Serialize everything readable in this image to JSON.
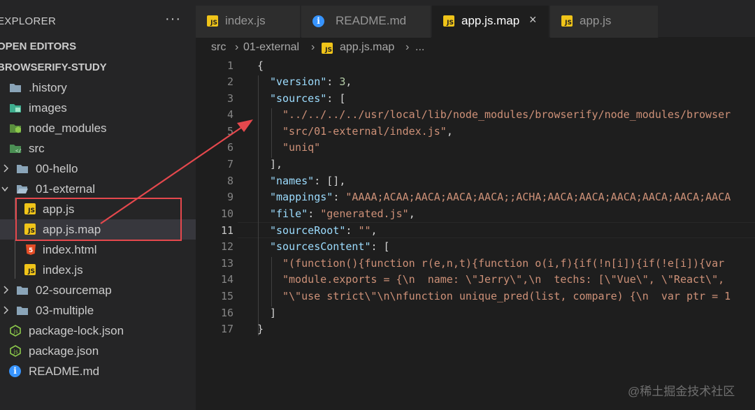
{
  "explorer": {
    "title": "EXPLORER",
    "more": "···",
    "open_editors": "OPEN EDITORS",
    "project": "BROWSERIFY-STUDY",
    "items": [
      {
        "label": ".history",
        "icon": "folder-icon"
      },
      {
        "label": "images",
        "icon": "images-folder-icon"
      },
      {
        "label": "node_modules",
        "icon": "node-folder-icon"
      },
      {
        "label": "src",
        "icon": "src-folder-icon"
      },
      {
        "label": "00-hello",
        "icon": "folder-icon"
      },
      {
        "label": "01-external",
        "icon": "folder-open-icon"
      },
      {
        "label": "app.js",
        "icon": "js-file-icon"
      },
      {
        "label": "app.js.map",
        "icon": "js-file-icon"
      },
      {
        "label": "index.html",
        "icon": "html-file-icon"
      },
      {
        "label": "index.js",
        "icon": "js-file-icon"
      },
      {
        "label": "02-sourcemap",
        "icon": "folder-icon"
      },
      {
        "label": "03-multiple",
        "icon": "folder-icon"
      },
      {
        "label": "package-lock.json",
        "icon": "json-file-icon"
      },
      {
        "label": "package.json",
        "icon": "json-file-icon"
      },
      {
        "label": "README.md",
        "icon": "info-icon"
      }
    ]
  },
  "tabs": [
    {
      "label": "index.js",
      "icon": "js-file-icon"
    },
    {
      "label": "README.md",
      "icon": "info-icon"
    },
    {
      "label": "app.js.map",
      "icon": "js-file-icon",
      "active": true
    },
    {
      "label": "app.js",
      "icon": "js-file-icon"
    }
  ],
  "tab_close": "×",
  "breadcrumb": [
    "src",
    "01-external",
    "app.js.map",
    "..."
  ],
  "breadcrumb_sep": "›",
  "editor": {
    "line_numbers": [
      "1",
      "2",
      "3",
      "4",
      "5",
      "6",
      "7",
      "8",
      "9",
      "10",
      "11",
      "12",
      "13",
      "14",
      "15",
      "16",
      "17"
    ],
    "current_line": "11"
  },
  "code": {
    "l1": "{",
    "l2_key": "\"version\"",
    "l2_rest": ": ",
    "l2_val": "3",
    "l2_end": ",",
    "l3_key": "\"sources\"",
    "l3_rest": ": [",
    "l4": "\"../../../../usr/local/lib/node_modules/browserify/node_modules/browser",
    "l5": "\"src/01-external/index.js\"",
    "l5_end": ",",
    "l6": "\"uniq\"",
    "l7": "],",
    "l8_key": "\"names\"",
    "l8_rest": ": [],",
    "l9_key": "\"mappings\"",
    "l9_rest": ": ",
    "l9_val": "\"AAAA;ACAA;AACA;AACA;AACA;;ACHA;AACA;AACA;AACA;AACA;AACA;AACA",
    "l10_key": "\"file\"",
    "l10_rest": ": ",
    "l10_val": "\"generated.js\"",
    "l10_end": ",",
    "l11_key": "\"sourceRoot\"",
    "l11_rest": ": ",
    "l11_val": "\"\"",
    "l11_end": ",",
    "l12_key": "\"sourcesContent\"",
    "l12_rest": ": [",
    "l13": "\"(function(){function r(e,n,t){function o(i,f){if(!n[i]){if(!e[i]){var",
    "l14": "\"module.exports = {\\n  name: \\\"Jerry\\\",\\n  techs: [\\\"Vue\\\", \\\"React\\\",",
    "l15": "\"\\\"use strict\\\"\\n\\nfunction unique_pred(list, compare) {\\n  var ptr = 1",
    "l16": "]",
    "l17": "}"
  },
  "watermark": "@稀土掘金技术社区",
  "colors": {
    "annotation": "#e5484d",
    "json_key": "#9cdcfe",
    "json_string": "#ce9178",
    "json_number": "#b5cea8"
  }
}
